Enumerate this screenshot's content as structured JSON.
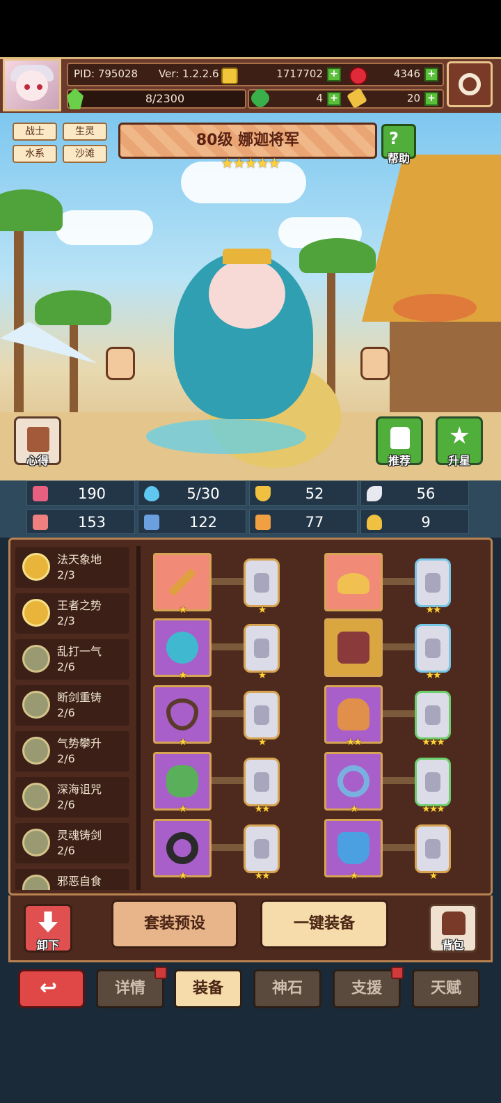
{
  "header": {
    "pid": "PID: 795028",
    "version": "Ver: 1.2.2.6",
    "gold": "1717702",
    "ruby": "4346",
    "stamina": "8/2300",
    "clover": "4",
    "key": "20"
  },
  "hero": {
    "tags": [
      "战士",
      "生灵",
      "水系",
      "沙滩"
    ],
    "title": "80级  娜迦将军",
    "stars": "★★★★★",
    "help_label": "帮助",
    "notes_label": "心得",
    "recommend_label": "推荐",
    "upgrade_label": "升星"
  },
  "stats": [
    {
      "icon": "heart-icon",
      "value": "190",
      "color": "#e86080"
    },
    {
      "icon": "water-drop-icon",
      "value": "5/30",
      "color": "#5ec8f0"
    },
    {
      "icon": "shield-icon",
      "value": "52",
      "color": "#f0c040"
    },
    {
      "icon": "wing-icon",
      "value": "56",
      "color": "#e8e8f0"
    },
    {
      "icon": "fist-icon",
      "value": "153",
      "color": "#f08080"
    },
    {
      "icon": "book-icon",
      "value": "122",
      "color": "#6aa0e0"
    },
    {
      "icon": "boot-icon",
      "value": "77",
      "color": "#f0a040"
    },
    {
      "icon": "horseshoe-icon",
      "value": "9",
      "color": "#f0c040"
    }
  ],
  "sets": [
    {
      "name": "法天象地",
      "count": "2/3",
      "medal": "gold"
    },
    {
      "name": "王者之势",
      "count": "2/3",
      "medal": "gold"
    },
    {
      "name": "乱打一气",
      "count": "2/6",
      "medal": "grey"
    },
    {
      "name": "断剑重铸",
      "count": "2/6",
      "medal": "grey"
    },
    {
      "name": "气势攀升",
      "count": "2/6",
      "medal": "grey"
    },
    {
      "name": "深海诅咒",
      "count": "2/6",
      "medal": "grey"
    },
    {
      "name": "灵魂铸剑",
      "count": "2/6",
      "medal": "grey"
    },
    {
      "name": "邪恶自食",
      "count": "",
      "medal": "grey"
    }
  ],
  "equipment": [
    {
      "slot": "weapon-stick",
      "frame": "red",
      "item_color": "#e0a040",
      "gem": "gold",
      "gem_stars": "★"
    },
    {
      "slot": "straw-hat",
      "frame": "red",
      "item_color": "#f0c050",
      "gem": "blue",
      "gem_stars": "★★"
    },
    {
      "slot": "bracer",
      "frame": "purple",
      "item_color": "#40b8d0",
      "gem": "gold",
      "gem_stars": "★"
    },
    {
      "slot": "armor",
      "frame": "gold",
      "item_color": "#8a3a3a",
      "gem": "blue",
      "gem_stars": "★★"
    },
    {
      "slot": "necklace",
      "frame": "purple",
      "item_color": "#5a3a2a",
      "gem": "gold",
      "gem_stars": "★"
    },
    {
      "slot": "gloves",
      "frame": "purple",
      "item_color": "#e0904a",
      "gem": "green",
      "gem_stars": "★★★"
    },
    {
      "slot": "green-charm",
      "frame": "purple",
      "item_color": "#5ab05a",
      "gem": "gold",
      "gem_stars": "★★"
    },
    {
      "slot": "ring",
      "frame": "purple",
      "item_color": "#7ab0e0",
      "gem": "green",
      "gem_stars": "★★★"
    },
    {
      "slot": "black-ring",
      "frame": "purple",
      "item_color": "#2a2a2a",
      "gem": "gold",
      "gem_stars": "★★"
    },
    {
      "slot": "boots",
      "frame": "purple",
      "item_color": "#4aa0e0",
      "gem": "gold",
      "gem_stars": "★"
    }
  ],
  "item_stars": [
    "★",
    "",
    "★",
    "★",
    "★",
    "★★",
    "★",
    "★",
    "★",
    "★"
  ],
  "actions": {
    "unequip_label": "卸下",
    "preset_label": "套装预设",
    "auto_equip_label": "一键装备",
    "bag_label": "背包"
  },
  "tabs": [
    {
      "label": "详情",
      "active": false,
      "dot": true
    },
    {
      "label": "装备",
      "active": true,
      "dot": false
    },
    {
      "label": "神石",
      "active": false,
      "dot": false
    },
    {
      "label": "支援",
      "active": false,
      "dot": true
    },
    {
      "label": "天赋",
      "active": false,
      "dot": false
    }
  ]
}
